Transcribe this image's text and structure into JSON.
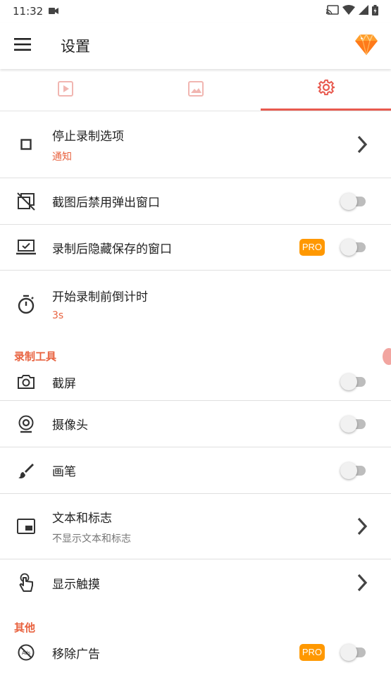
{
  "status_bar": {
    "time": "11:32",
    "icons": [
      "video-camera-icon",
      "cast-icon",
      "wifi-icon",
      "cell-signal-icon",
      "battery-icon"
    ]
  },
  "app_bar": {
    "menu_icon": "hamburger-menu-icon",
    "title": "设置",
    "pro_icon": "diamond-gem-icon"
  },
  "tabs": [
    {
      "icon": "video-play-icon",
      "active": false
    },
    {
      "icon": "image-icon",
      "active": false
    },
    {
      "icon": "gear-icon",
      "active": true
    }
  ],
  "colors": {
    "accent": "#e85a4f",
    "sub_text": "#e8623f",
    "pro_badge": "#ff9800"
  },
  "settings": {
    "stop_recording": {
      "label": "停止录制选项",
      "value": "通知"
    },
    "disable_popup": {
      "label": "截图后禁用弹出窗口",
      "enabled": false
    },
    "hide_saved_window": {
      "label": "录制后隐藏保存的窗口",
      "badge": "PRO",
      "enabled": false
    },
    "countdown": {
      "label": "开始录制前倒计时",
      "value": "3s"
    }
  },
  "recording_tools": {
    "header": "录制工具",
    "screenshot": {
      "label": "截屏",
      "enabled": false
    },
    "camera": {
      "label": "摄像头",
      "enabled": false
    },
    "brush": {
      "label": "画笔",
      "enabled": false
    },
    "text_logo": {
      "label": "文本和标志",
      "value": "不显示文本和标志"
    },
    "show_touches": {
      "label": "显示触摸"
    }
  },
  "other": {
    "header": "其他",
    "remove_ads": {
      "label": "移除广告",
      "badge": "PRO",
      "enabled": false
    }
  }
}
